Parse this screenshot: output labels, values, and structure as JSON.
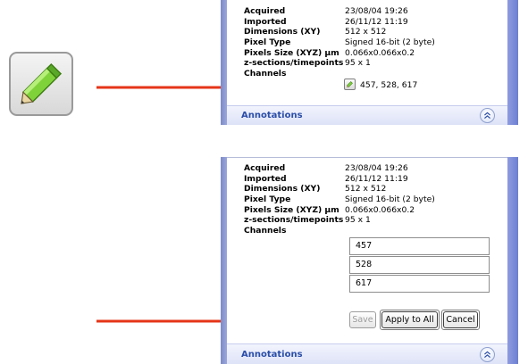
{
  "icons": {
    "big_pencil": "pencil-edit-icon",
    "small_pencil": "pencil-edit-icon",
    "collapse": "double-chevron-up-icon"
  },
  "colors": {
    "arrow": "#e53518",
    "panel_border": "#7d8bd8",
    "annotations_text": "#2b4ea8"
  },
  "metadata_rows": [
    {
      "label": "Acquired",
      "value": "23/08/04 19:26"
    },
    {
      "label": "Imported",
      "value": "26/11/12 11:19"
    },
    {
      "label": "Dimensions (XY)",
      "value": "512 x 512"
    },
    {
      "label": "Pixel Type",
      "value": "Signed 16-bit (2 byte)"
    },
    {
      "label": "Pixels Size (XYZ) µm",
      "value": "0.066x0.066x0.2"
    },
    {
      "label": "z-sections/timepoints",
      "value": "95 x 1"
    }
  ],
  "channels_label": "Channels",
  "top_panel": {
    "channels_value": "457, 528, 617",
    "annotations_label": "Annotations"
  },
  "bottom_panel": {
    "channel_inputs": [
      "457",
      "528",
      "617"
    ],
    "buttons": {
      "save": "Save",
      "apply_to_all": "Apply to All",
      "cancel": "Cancel"
    },
    "annotations_label": "Annotations"
  }
}
